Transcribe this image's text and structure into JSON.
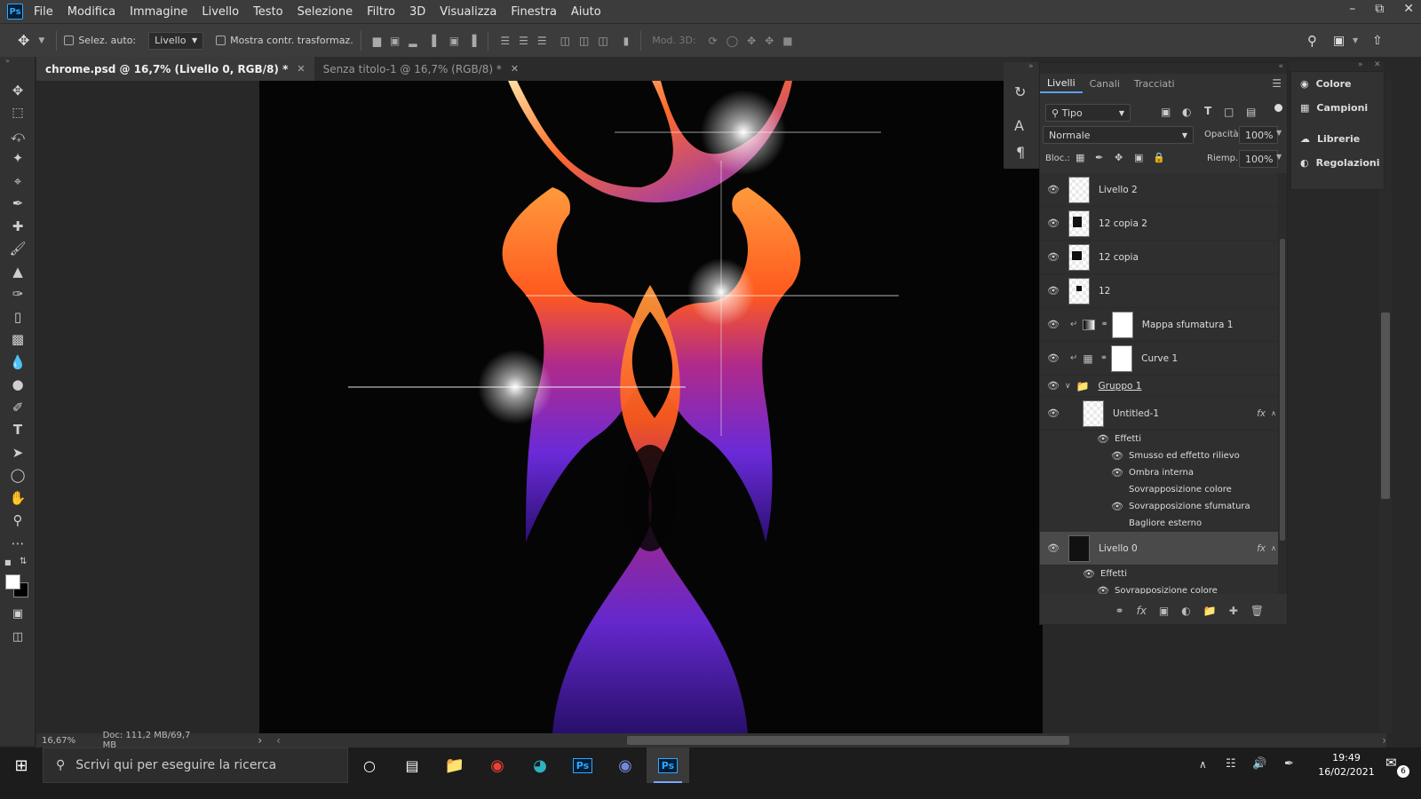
{
  "app": {
    "logo": "Ps",
    "menu": [
      "File",
      "Modifica",
      "Immagine",
      "Livello",
      "Testo",
      "Selezione",
      "Filtro",
      "3D",
      "Visualizza",
      "Finestra",
      "Aiuto"
    ]
  },
  "options": {
    "auto_select_label": "Selez. auto:",
    "auto_select_value": "Livello",
    "show_transform_label": "Mostra contr. trasformaz.",
    "mode3d_label": "Mod. 3D:"
  },
  "tabs": [
    {
      "label": "chrome.psd @ 16,7% (Livello 0, RGB/8) *",
      "active": true
    },
    {
      "label": "Senza titolo-1 @ 16,7% (RGB/8) *",
      "active": false
    }
  ],
  "status": {
    "zoom": "16,67%",
    "doc": "Doc: 111,2 MB/69,7 MB",
    "arrow": "›"
  },
  "layers_panel": {
    "tabs": [
      "Livelli",
      "Canali",
      "Tracciati"
    ],
    "filter": "Tipo",
    "blend_mode": "Normale",
    "opacity_label": "Opacità:",
    "opacity": "100%",
    "lock_label": "Bloc.:",
    "fill_label": "Riemp.:",
    "fill": "100%",
    "layers": [
      {
        "name": "Livello 2",
        "type": "pixel"
      },
      {
        "name": "12 copia 2",
        "type": "smart"
      },
      {
        "name": "12 copia",
        "type": "smart"
      },
      {
        "name": "12",
        "type": "smart"
      },
      {
        "name": "Mappa sfumatura 1",
        "type": "adjustment"
      },
      {
        "name": "Curve 1",
        "type": "adjustment"
      },
      {
        "name": "Gruppo 1",
        "type": "group"
      },
      {
        "name": "Untitled-1",
        "type": "smart-fx"
      },
      {
        "name": "Livello 0",
        "type": "fx"
      }
    ],
    "untitled_effects": {
      "header": "Effetti",
      "items": [
        "Smusso ed effetto rilievo",
        "Ombra interna",
        "Sovrapposizione colore",
        "Sovrapposizione sfumatura",
        "Bagliore esterno"
      ]
    },
    "livello0_effects": {
      "header": "Effetti",
      "items": [
        "Sovrapposizione colore"
      ]
    },
    "fx_label": "fx"
  },
  "right_panel": {
    "items": [
      "Colore",
      "Campioni",
      "Librerie",
      "Regolazioni"
    ]
  },
  "taskbar": {
    "search_placeholder": "Scrivi qui per eseguire la ricerca",
    "time": "19:49",
    "date": "16/02/2021",
    "notif_count": "6",
    "ps_label": "Ps"
  },
  "colors": {
    "accent": "#31a8ff",
    "panel": "#323232",
    "canvas_bg": "#050505"
  }
}
